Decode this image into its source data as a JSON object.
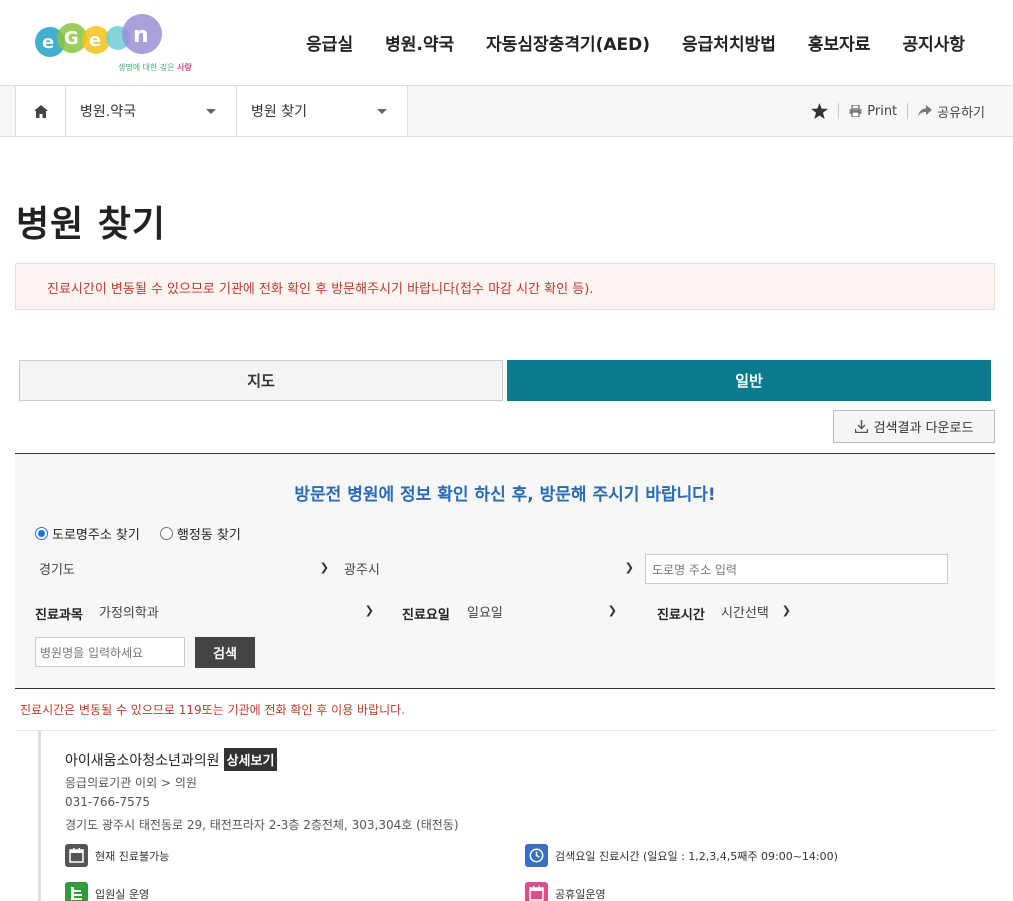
{
  "logo": {
    "alt": "EGEN",
    "tagline_prefix": "생명에 대한 깊은",
    "tagline_emph": "사랑"
  },
  "gnb": [
    {
      "label": "응급실"
    },
    {
      "label": "병원.약국"
    },
    {
      "label": "자동심장충격기(AED)"
    },
    {
      "label": "응급처치방법"
    },
    {
      "label": "홍보자료"
    },
    {
      "label": "공지사항"
    }
  ],
  "breadcrumb": {
    "level1": "병원.약국",
    "level2": "병원 찾기"
  },
  "utils": {
    "print": "Print",
    "share": "공유하기"
  },
  "page": {
    "title": "병원 찾기",
    "notice": "진료시간이 변동될 수 있으므로 기관에 전화 확인 후 방문해주시기 바랍니다(접수 마감 시간 확인 등)."
  },
  "tabs": {
    "map": "지도",
    "general": "일반"
  },
  "download": {
    "label": "검색결과 다운로드"
  },
  "search": {
    "title": "방문전 병원에 정보 확인 하신 후, 방문해 주시기 바랍니다!",
    "radio_road": "도로명주소 찾기",
    "radio_admin": "행정동 찾기",
    "province": "경기도",
    "city": "광주시",
    "road_placeholder": "도로명 주소 입력",
    "dept_label": "진료과목",
    "dept_value": "가정의학과",
    "day_label": "진료요일",
    "day_value": "일요일",
    "time_label": "진료시간",
    "time_value": "시간선택",
    "name_placeholder": "병원명을 입력하세요",
    "button": "검색"
  },
  "result_notice": "진료시간은 변동될 수 있으므로 119또는 기관에 전화 확인 후 이용 바랍니다.",
  "result": {
    "name": "아이새움소아청소년과의원",
    "detail_button": "상세보기",
    "category": "응급의료기관 이외 > 의원",
    "phone": "031-766-7575",
    "address": "경기도 광주시 태전동로 29, 태전프라자 2-3층 2층전체, 303,304호 (태전동)",
    "features": [
      {
        "icon": "calendar-icon",
        "color": "#555555",
        "text": "현재 진료불가능"
      },
      {
        "icon": "clock-icon",
        "color": "#3b6fc4",
        "text": "검색요일 진료시간 (일요일 : 1,2,3,4,5째주 09:00~14:00)"
      },
      {
        "icon": "bed-icon",
        "color": "#2e9e3a",
        "text": "입원실 운영"
      },
      {
        "icon": "holiday-calendar-icon",
        "color": "#d94f8a",
        "text": "공휴일운영"
      }
    ]
  },
  "colors": {
    "accent": "#0a7a8f",
    "title_blue": "#2a6bb5",
    "warning_red": "#c0392b"
  }
}
